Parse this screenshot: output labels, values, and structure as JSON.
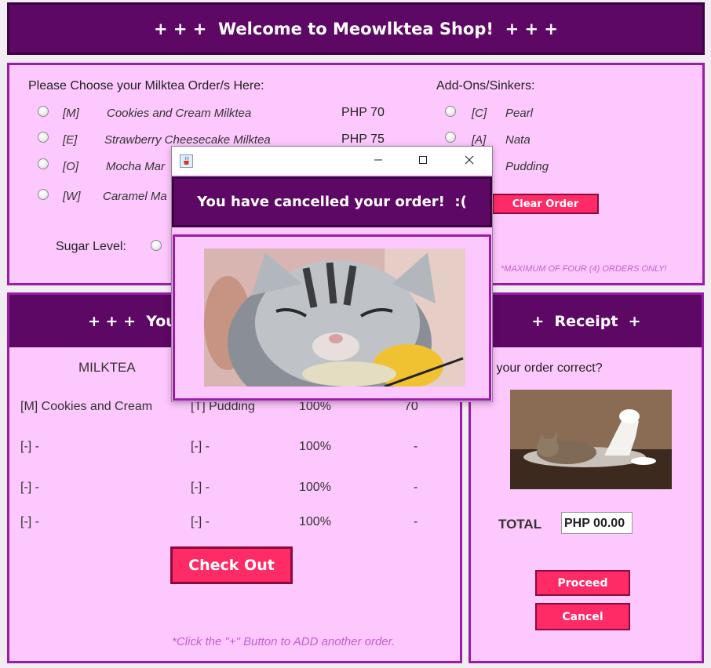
{
  "app": {
    "title": "+ + +  Welcome to Meowlktea Shop!  + + +",
    "colors": {
      "banner": "#5e0866",
      "panel": "#fdc8fd",
      "border": "#9a1da8",
      "button": "#ff2b66",
      "note": "#c060d0"
    }
  },
  "order_form": {
    "heading": "Please Choose your Milktea Order/s Here:",
    "milkteas": [
      {
        "code": "[M]",
        "name": "Cookies and Cream Milktea",
        "price": "PHP 70"
      },
      {
        "code": "[E]",
        "name": "Strawberry Cheesecake Milktea",
        "price": "PHP 75"
      },
      {
        "code": "[O]",
        "name": "Mocha Mar",
        "price": ""
      },
      {
        "code": "[W]",
        "name": "Caramel Ma",
        "price": ""
      }
    ],
    "addons_heading": "Add-Ons/Sinkers:",
    "addons": [
      {
        "code": "[C]",
        "name": "Pearl"
      },
      {
        "code": "[A]",
        "name": "Nata"
      },
      {
        "code": "",
        "name": "Pudding"
      }
    ],
    "clear_button": "Clear Order",
    "sugar_label": "Sugar Level:",
    "max_note": "*MAXIMUM OF FOUR (4) ORDERS ONLY!"
  },
  "your_order": {
    "header": "+ + +  Your",
    "column_milktea": "MILKTEA",
    "rows": [
      {
        "milktea": "[M] Cookies and Cream",
        "addon": "[T] Pudding",
        "sugar": "100%",
        "price": "70"
      },
      {
        "milktea": "[-] -",
        "addon": "[-] -",
        "sugar": "100%",
        "price": "-"
      },
      {
        "milktea": "[-] -",
        "addon": "[-] -",
        "sugar": "100%",
        "price": "-"
      },
      {
        "milktea": "[-] -",
        "addon": "[-] -",
        "sugar": "100%",
        "price": "-"
      }
    ],
    "checkout_button": "Check Out",
    "add_note": "*Click the \"+\" Button to ADD another order."
  },
  "receipt": {
    "header": "+  Receipt  +",
    "question": "s your order correct?",
    "total_label": "TOTAL",
    "total_value": "PHP 00.00",
    "proceed_button": "Proceed",
    "cancel_button": "Cancel"
  },
  "dialog": {
    "message": "You have cancelled your order!  :(",
    "app_icon": "java-coffee-cup-icon",
    "image": "sleepy-kitten-photo"
  }
}
